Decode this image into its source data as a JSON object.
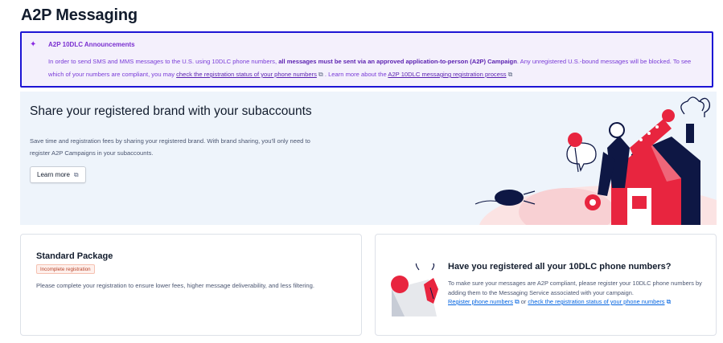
{
  "page": {
    "title": "A2P Messaging"
  },
  "announcement": {
    "title": "A2P 10DLC Announcements",
    "text_1": "In order to send SMS and MMS messages to the U.S. using 10DLC phone numbers, ",
    "bold_text": "all messages must be sent via an approved application-to-person (A2P) Campaign",
    "text_2": ". Any unregistered U.S.-bound messages will be blocked. To see which of your numbers are compliant, you may ",
    "link_1": "check the registration status of your phone numbers",
    "text_3": " . Learn more about the ",
    "link_2": "A2P 10DLC messaging registration process",
    "icon": "sparkle-icon"
  },
  "hero": {
    "title": "Share your registered brand with your subaccounts",
    "description": "Save time and registration fees by sharing your registered brand. With brand sharing, you'll only need to register A2P Campaigns in your subaccounts.",
    "button_label": "Learn more",
    "external_icon": "⧉"
  },
  "standard_card": {
    "title": "Standard Package",
    "badge": "Incomplete registration",
    "description": "Please complete your registration to ensure lower fees, higher message deliverability, and less filtering."
  },
  "numbers_card": {
    "title": "Have you registered all your 10DLC phone numbers?",
    "text_1": "To make sure your messages are A2P compliant, please register your 10DLC phone numbers by adding them to the Messaging Service associated with your campaign.",
    "link_1": "Register phone numbers",
    "text_2": " or ",
    "link_2": "check the registration status of your phone numbers"
  },
  "colors": {
    "accent": "#7a2fd0",
    "announcement_border": "#1c14d4",
    "link": "#0263e0",
    "hero_bg": "#eef4fb",
    "badge_text": "#b8442a",
    "illustration_red": "#e8253f",
    "illustration_navy": "#0e1744"
  }
}
